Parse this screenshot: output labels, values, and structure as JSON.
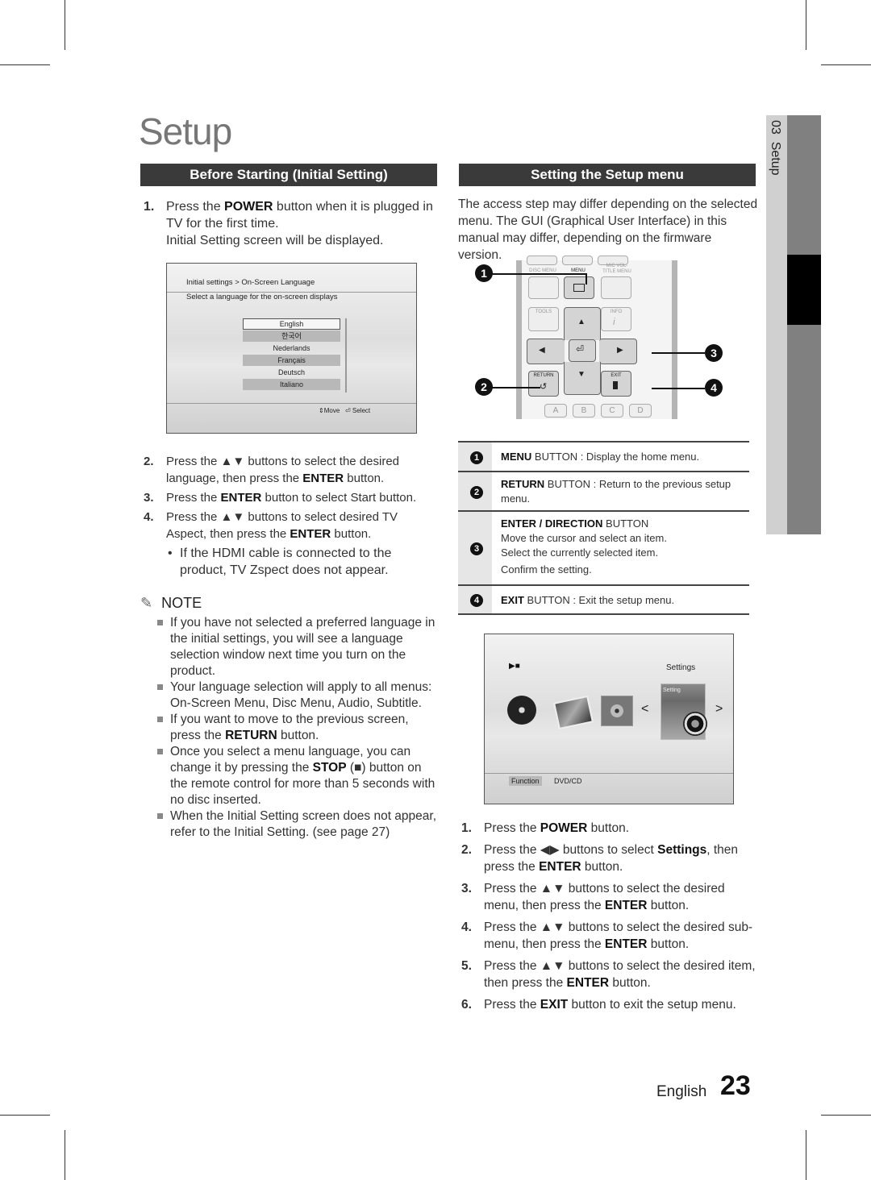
{
  "page": {
    "title": "Setup",
    "side_tab": {
      "chapter": "03",
      "label": "Setup"
    },
    "footer": {
      "language": "English",
      "page_number": "23"
    }
  },
  "left": {
    "header": "Before Starting (Initial Setting)",
    "step1": {
      "num": "1.",
      "pre": "Press the ",
      "bold": "POWER",
      "post": " button when it is plugged in TV for the first time.",
      "line2": "Initial Setting screen will be displayed."
    },
    "screen": {
      "breadcrumb": "Initial settings > On-Screen Language",
      "instruction": "Select a language for the on-screen displays",
      "languages": [
        "English",
        "한국어",
        "Nederlands",
        "Français",
        "Deutsch",
        "Italiano"
      ],
      "selected_language": "English",
      "hint_move": "Move",
      "hint_select": "Select"
    },
    "steps": [
      {
        "num": "2.",
        "pre": "Press the ▲▼ buttons to select the desired language, then press the ",
        "bold": "ENTER",
        "post": " button."
      },
      {
        "num": "3.",
        "pre": "Press the ",
        "bold": "ENTER",
        "post": " button to select Start button."
      },
      {
        "num": "4.",
        "pre": "Press the ▲▼ buttons to select desired TV Aspect, then press the ",
        "bold": "ENTER",
        "post": " button."
      }
    ],
    "bullet": "If the HDMI cable is connected to the product, TV Zspect does not appear.",
    "note": {
      "heading": "NOTE",
      "items": [
        {
          "pre": "If you have not selected a preferred language in the initial settings, you will see a language selection window next time you turn on the product.",
          "bold": "",
          "post": ""
        },
        {
          "pre": "Your language selection will apply to all menus: On-Screen Menu, Disc Menu, Audio, Subtitle.",
          "bold": "",
          "post": ""
        },
        {
          "pre": "If you want to move to the previous screen, press the ",
          "bold": "RETURN",
          "post": " button."
        },
        {
          "pre": "Once you select a menu language, you can change it by pressing the ",
          "bold": "STOP",
          "post": " (■) button on the remote control for more than 5 seconds with no disc inserted."
        },
        {
          "pre": "When the Initial Setting screen does not appear, refer to the Initial Setting. (see page 27)",
          "bold": "",
          "post": ""
        }
      ]
    }
  },
  "right": {
    "header": "Setting the Setup menu",
    "intro": "The access step may differ depending on the selected menu. The GUI (Graphical User Interface) in this manual may differ, depending on the firmware version.",
    "remote": {
      "labels": {
        "disc_menu": "DISC MENU",
        "menu": "MENU",
        "mic_vol": "MIC VOL-",
        "title_menu": "TITLE MENU",
        "tools": "TOOLS",
        "info": "INFO",
        "return": "RETURN",
        "exit": "EXIT"
      },
      "color_keys": [
        "A",
        "B",
        "C",
        "D"
      ],
      "callouts": [
        "1",
        "2",
        "3",
        "4"
      ]
    },
    "table": [
      {
        "num": "1",
        "bold": "MENU",
        "text": " BUTTON : Display the home menu.",
        "extra": []
      },
      {
        "num": "2",
        "bold": "RETURN",
        "text": " BUTTON : Return to the previous setup menu.",
        "extra": []
      },
      {
        "num": "3",
        "bold": "ENTER / DIRECTION",
        "text": " BUTTON",
        "extra": [
          "Move the cursor and select an item.",
          "Select the currently selected item.",
          "Confirm the setting."
        ]
      },
      {
        "num": "4",
        "bold": "EXIT",
        "text": " BUTTON : Exit the setup menu.",
        "extra": []
      }
    ],
    "home_screen": {
      "play_icon": "▶■",
      "selected_label": "Settings",
      "card_label": "Setting",
      "tab_function": "Function",
      "tab_source": "DVD/CD"
    },
    "steps": [
      {
        "num": "1.",
        "parts": [
          [
            "Press the ",
            false
          ],
          [
            "POWER",
            true
          ],
          [
            " button.",
            false
          ]
        ]
      },
      {
        "num": "2.",
        "parts": [
          [
            "Press the ◀▶ buttons to select ",
            false
          ],
          [
            "Settings",
            true
          ],
          [
            ", then press the ",
            false
          ],
          [
            "ENTER",
            true
          ],
          [
            " button.",
            false
          ]
        ]
      },
      {
        "num": "3.",
        "parts": [
          [
            "Press the ▲▼ buttons to select the desired menu, then press the ",
            false
          ],
          [
            "ENTER",
            true
          ],
          [
            " button.",
            false
          ]
        ]
      },
      {
        "num": "4.",
        "parts": [
          [
            "Press the ▲▼ buttons to select the desired sub-menu, then press the ",
            false
          ],
          [
            "ENTER",
            true
          ],
          [
            " button.",
            false
          ]
        ]
      },
      {
        "num": "5.",
        "parts": [
          [
            "Press the ▲▼ buttons to select the desired item, then press the ",
            false
          ],
          [
            "ENTER",
            true
          ],
          [
            " button.",
            false
          ]
        ]
      },
      {
        "num": "6.",
        "parts": [
          [
            "Press the ",
            false
          ],
          [
            "EXIT",
            true
          ],
          [
            " button to exit the setup menu.",
            false
          ]
        ]
      }
    ]
  }
}
